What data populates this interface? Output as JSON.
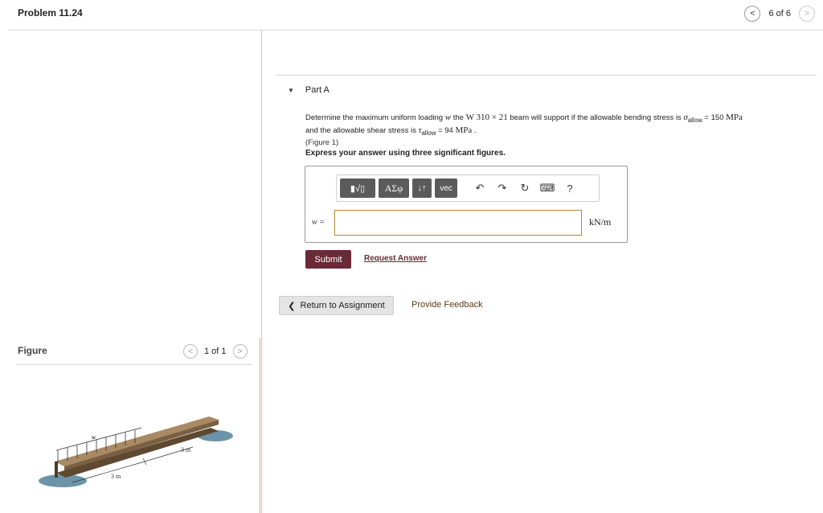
{
  "header": {
    "title": "Problem 11.24",
    "pager_text": "6 of 6"
  },
  "figure_panel": {
    "title": "Figure",
    "pager_text": "1 of 1",
    "label_w": "w",
    "label_span1": "3 m",
    "label_span2": "3 m"
  },
  "part": {
    "label": "Part A",
    "question": {
      "t1": "Determine the maximum uniform loading ",
      "var_w": "w",
      "t2": " the ",
      "beam": "W 310 × 21",
      "t3": " beam will support if the allowable bending stress is ",
      "sigma": "σ",
      "allow1": "allow",
      "t4": " = 150 ",
      "mpa1": "MPa",
      "t5": "and the allowable shear stress is ",
      "tau": "τ",
      "allow2": "allow",
      "t6": " = 94 ",
      "mpa2": "MPa",
      "t7": " .",
      "figure_link": "(Figure 1)"
    },
    "instruction": "Express your answer using three significant figures."
  },
  "answer": {
    "toolbar": {
      "sqrt_label": "▮√▯",
      "greek_label": "ΑΣφ",
      "arrows_label": "↓↑",
      "vec_label": "vec",
      "help_label": "?"
    },
    "variable_label": "w =",
    "input_value": "",
    "unit": "kN/m"
  },
  "actions": {
    "submit_label": "Submit",
    "request_label": "Request Answer",
    "return_label": "Return to Assignment",
    "feedback_label": "Provide Feedback"
  }
}
